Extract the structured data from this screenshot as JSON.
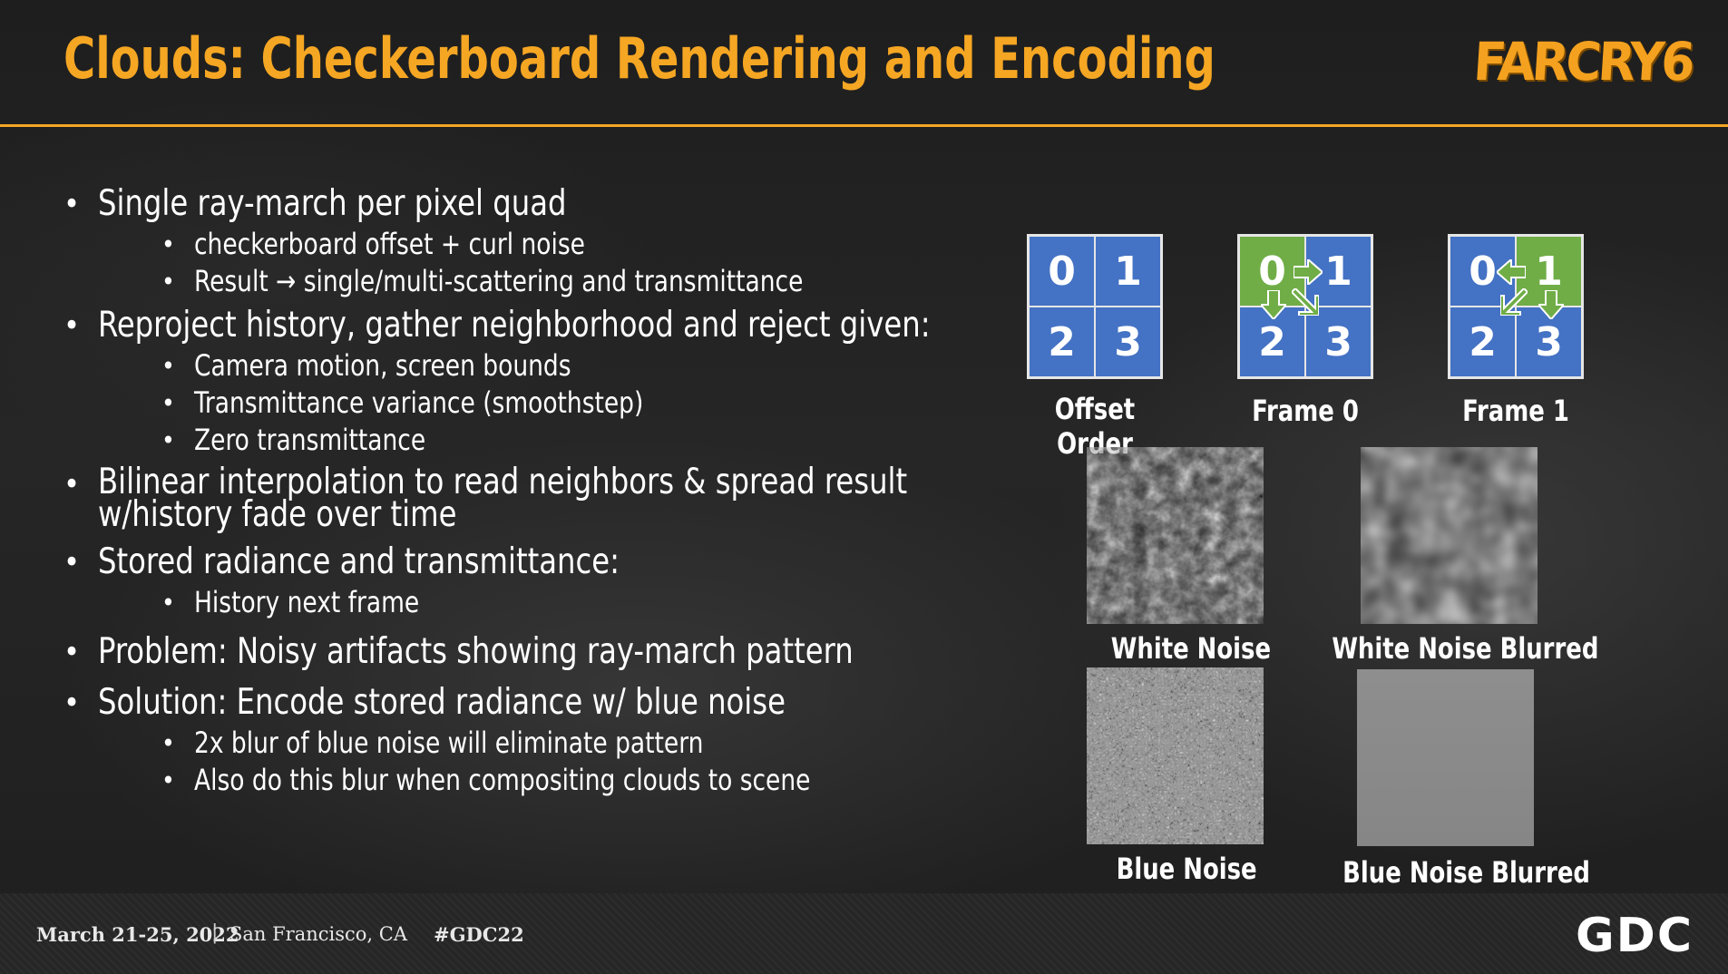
{
  "title": "Clouds: Checkerboard Rendering and Encoding",
  "brand_logo": "FARCRY6",
  "colors": {
    "accent": "#f5a623",
    "grid_blue": "#4472c4",
    "grid_green": "#70ad47"
  },
  "bullets": [
    {
      "text": "Single ray-march per pixel quad",
      "subs": [
        "checkerboard offset + curl noise",
        "Result → single/multi-scattering and transmittance"
      ]
    },
    {
      "text": "Reproject history, gather neighborhood and reject given:",
      "subs": [
        "Camera motion, screen bounds",
        "Transmittance variance (smoothstep)",
        "Zero transmittance"
      ]
    },
    {
      "text": "Bilinear interpolation to read neighbors & spread result w/history fade over time",
      "subs": []
    },
    {
      "text": "Stored radiance and transmittance:",
      "subs": [
        "History next frame"
      ]
    },
    {
      "text": "Problem: Noisy artifacts showing ray-march pattern",
      "subs": []
    },
    {
      "text": "Solution:  Encode stored radiance w/ blue noise",
      "subs": [
        "2x blur of blue noise will eliminate pattern",
        "Also do this blur when compositing clouds to scene"
      ]
    }
  ],
  "diagrams": [
    {
      "label": "Offset Order",
      "cells": [
        "0",
        "1",
        "2",
        "3"
      ]
    },
    {
      "label": "Frame 0",
      "cells": [
        "0",
        "1",
        "2",
        "3"
      ]
    },
    {
      "label": "Frame 1",
      "cells": [
        "0",
        "1",
        "2",
        "3"
      ]
    }
  ],
  "noise_images": [
    {
      "label": "White Noise",
      "icon": "white-noise-image"
    },
    {
      "label": "White Noise Blurred",
      "icon": "white-noise-blurred-image"
    },
    {
      "label": "Blue Noise",
      "icon": "blue-noise-image"
    },
    {
      "label": "Blue Noise Blurred",
      "icon": "blue-noise-blurred-image"
    }
  ],
  "footer": {
    "date": "March 21-25, 2022",
    "separator": "|",
    "location": "San Francisco, CA",
    "hashtag": "#GDC22",
    "logo": "GDC"
  }
}
